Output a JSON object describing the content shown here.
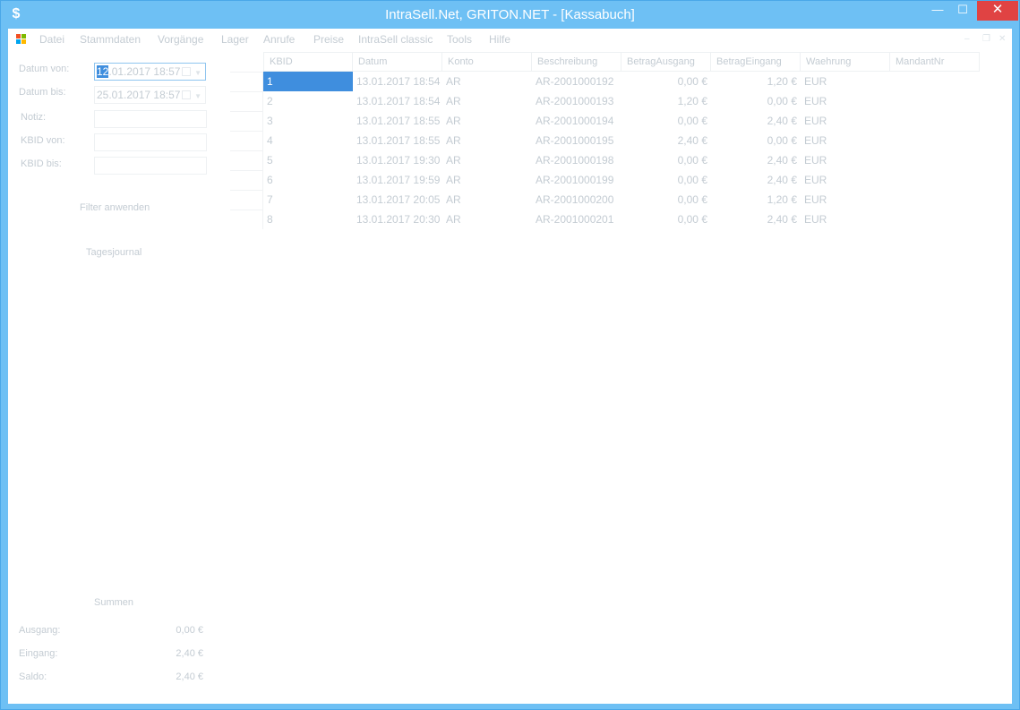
{
  "window": {
    "title": "IntraSell.Net, GRITON.NET - [Kassabuch]",
    "app_icon_glyph": "$",
    "controls": {
      "minimize": "—",
      "maximize": "☐",
      "close": "✕"
    }
  },
  "menu": {
    "items": [
      "Datei",
      "Stammdaten",
      "Vorgänge",
      "Lager",
      "Anrufe",
      "Preise",
      "IntraSell classic",
      "Tools",
      "Hilfe"
    ],
    "mdi_controls": {
      "minimize": "–",
      "restore": "❐",
      "close": "✕"
    }
  },
  "filters": {
    "datum_von": {
      "label": "Datum von:",
      "value_selected": "12",
      "value_rest": ".01.2017 18:57"
    },
    "datum_bis": {
      "label": "Datum bis:",
      "value": "25.01.2017 18:57"
    },
    "notiz": {
      "label": "Notiz:",
      "value": ""
    },
    "kbid_von": {
      "label": "KBID von:",
      "value": ""
    },
    "kbid_bis": {
      "label": "KBID bis:",
      "value": ""
    },
    "apply_button": "Filter anwenden",
    "journal_button": "Tagesjournal"
  },
  "grid": {
    "columns": [
      "KBID",
      "Datum",
      "Konto",
      "Beschreibung",
      "BetragAusgang",
      "BetragEingang",
      "Waehrung",
      "MandantNr"
    ],
    "rows": [
      [
        "1",
        "13.01.2017 18:54",
        "AR",
        "AR-2001000192",
        "0,00 €",
        "1,20 €",
        "EUR",
        ""
      ],
      [
        "2",
        "13.01.2017 18:54",
        "AR",
        "AR-2001000193",
        "1,20 €",
        "0,00 €",
        "EUR",
        ""
      ],
      [
        "3",
        "13.01.2017 18:55",
        "AR",
        "AR-2001000194",
        "0,00 €",
        "2,40 €",
        "EUR",
        ""
      ],
      [
        "4",
        "13.01.2017 18:55",
        "AR",
        "AR-2001000195",
        "2,40 €",
        "0,00 €",
        "EUR",
        ""
      ],
      [
        "5",
        "13.01.2017 19:30",
        "AR",
        "AR-2001000198",
        "0,00 €",
        "2,40 €",
        "EUR",
        ""
      ],
      [
        "6",
        "13.01.2017 19:59",
        "AR",
        "AR-2001000199",
        "0,00 €",
        "2,40 €",
        "EUR",
        ""
      ],
      [
        "7",
        "13.01.2017 20:05",
        "AR",
        "AR-2001000200",
        "0,00 €",
        "1,20 €",
        "EUR",
        ""
      ],
      [
        "8",
        "13.01.2017 20:30",
        "AR",
        "AR-2001000201",
        "0,00 €",
        "2,40 €",
        "EUR",
        ""
      ]
    ]
  },
  "summen": {
    "title": "Summen",
    "ausgang": {
      "label": "Ausgang:",
      "value": "0,00 €"
    },
    "eingang": {
      "label": "Eingang:",
      "value": "2,40 €"
    },
    "saldo": {
      "label": "Saldo:",
      "value": "2,40 €"
    }
  },
  "colors": {
    "titlebar": "#6ec0f4",
    "selection": "#3f8ede",
    "close": "#e04343"
  }
}
